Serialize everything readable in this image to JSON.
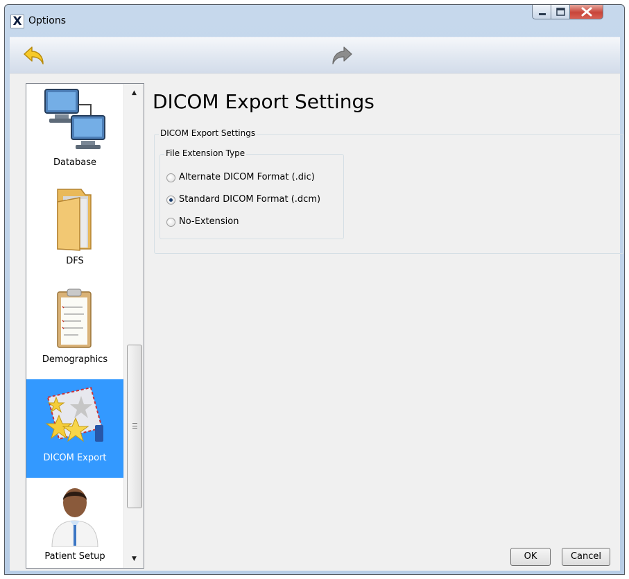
{
  "window": {
    "title": "Options",
    "app_icon_glyph": "X"
  },
  "toolbar": {
    "back_icon": "back-arrow-icon",
    "forward_icon": "forward-arrow-icon"
  },
  "nav": {
    "items": [
      {
        "label": "Database",
        "icon": "network-computers-icon"
      },
      {
        "label": "DFS",
        "icon": "folder-icon"
      },
      {
        "label": "Demographics",
        "icon": "clipboard-icon"
      },
      {
        "label": "DICOM Export",
        "icon": "envelope-stars-icon",
        "selected": true
      },
      {
        "label": "Patient Setup",
        "icon": "patient-avatar-icon"
      }
    ]
  },
  "content": {
    "page_title": "DICOM Export Settings",
    "outer_group_label": "DICOM Export Settings",
    "inner_group_label": "File Extension Type",
    "options": [
      {
        "label": "Alternate DICOM Format (.dic)",
        "checked": false
      },
      {
        "label": "Standard DICOM Format (.dcm)",
        "checked": true
      },
      {
        "label": "No-Extension",
        "checked": false
      }
    ]
  },
  "buttons": {
    "ok": "OK",
    "cancel": "Cancel"
  },
  "colors": {
    "selection": "#3399ff",
    "window_frame": "#b8cde6",
    "client_bg": "#f0f0f0",
    "close_button": "#c8453a"
  }
}
